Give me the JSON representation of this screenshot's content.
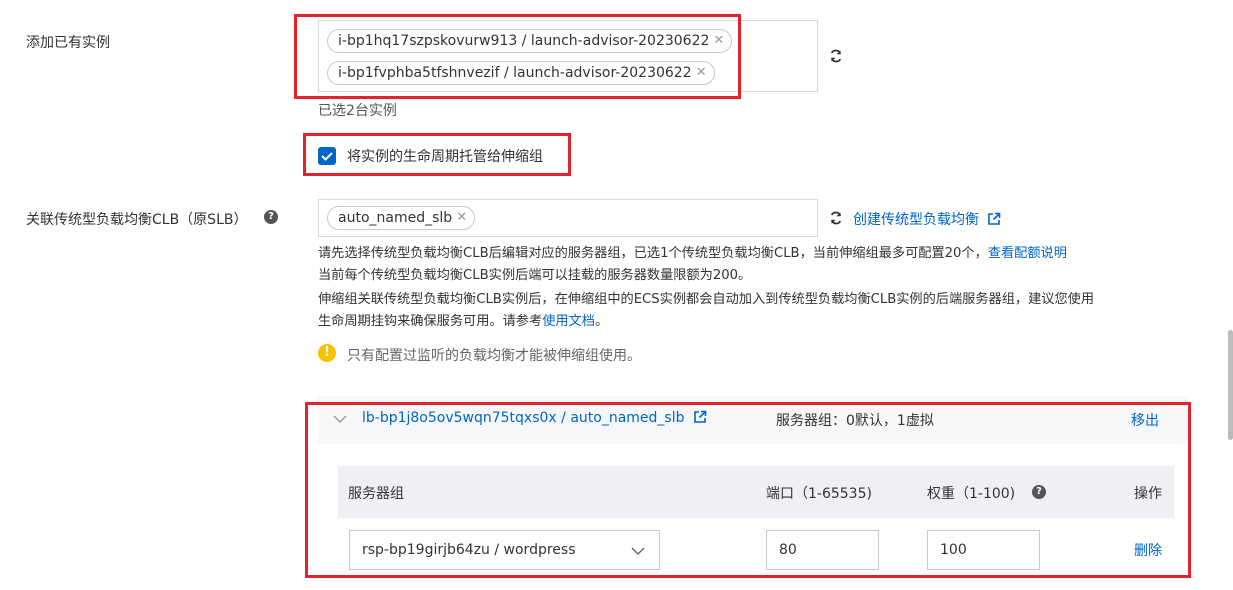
{
  "add_instance": {
    "label": "添加已有实例",
    "tags": [
      "i-bp1hq17szpskovurw913 / launch-advisor-20230622",
      "i-bp1fvphba5tfshnvezif / launch-advisor-20230622"
    ],
    "selected_count_text": "已选2台实例",
    "lifecycle_checkbox_label": "将实例的生命周期托管给伸缩组",
    "lifecycle_checked": true
  },
  "clb": {
    "label": "关联传统型负载均衡CLB（原SLB）",
    "tags": [
      "auto_named_slb"
    ],
    "create_link": "创建传统型负载均衡",
    "tip_line1": "请先选择传统型负载均衡CLB后编辑对应的服务器组，已选1个传统型负载均衡CLB，当前伸缩组最多可配置20个，",
    "tip_line1_link": "查看配额说明",
    "tip_line2": "当前每个传统型负载均衡CLB实例后端可以挂载的服务器数量限额为200。",
    "tip_line3": "伸缩组关联传统型负载均衡CLB实例后，在伸缩组中的ECS实例都会自动加入到传统型负载均衡CLB实例的后端服务器组，建议您使用",
    "tip_line4": "生命周期挂钩来确保服务可用。请参考",
    "tip_line4_link": "使用文档",
    "tip_line4_end": "。",
    "warning": "只有配置过监听的负载均衡才能被伸缩组使用。"
  },
  "lb_panel": {
    "title": "lb-bp1j8o5ov5wqn75tqxs0x / auto_named_slb",
    "server_group_summary": "服务器组：0默认，1虚拟",
    "remove_label": "移出",
    "columns": {
      "group": "服务器组",
      "port": "端口（1-65535)",
      "weight": "权重（1-100)",
      "action": "操作"
    },
    "rows": [
      {
        "group": "rsp-bp19girjb64zu / wordpress",
        "port": "80",
        "weight": "100",
        "action": "删除"
      }
    ]
  },
  "colors": {
    "accent": "#0064c8",
    "highlight": "#e0232e",
    "warning": "#f5c400"
  }
}
